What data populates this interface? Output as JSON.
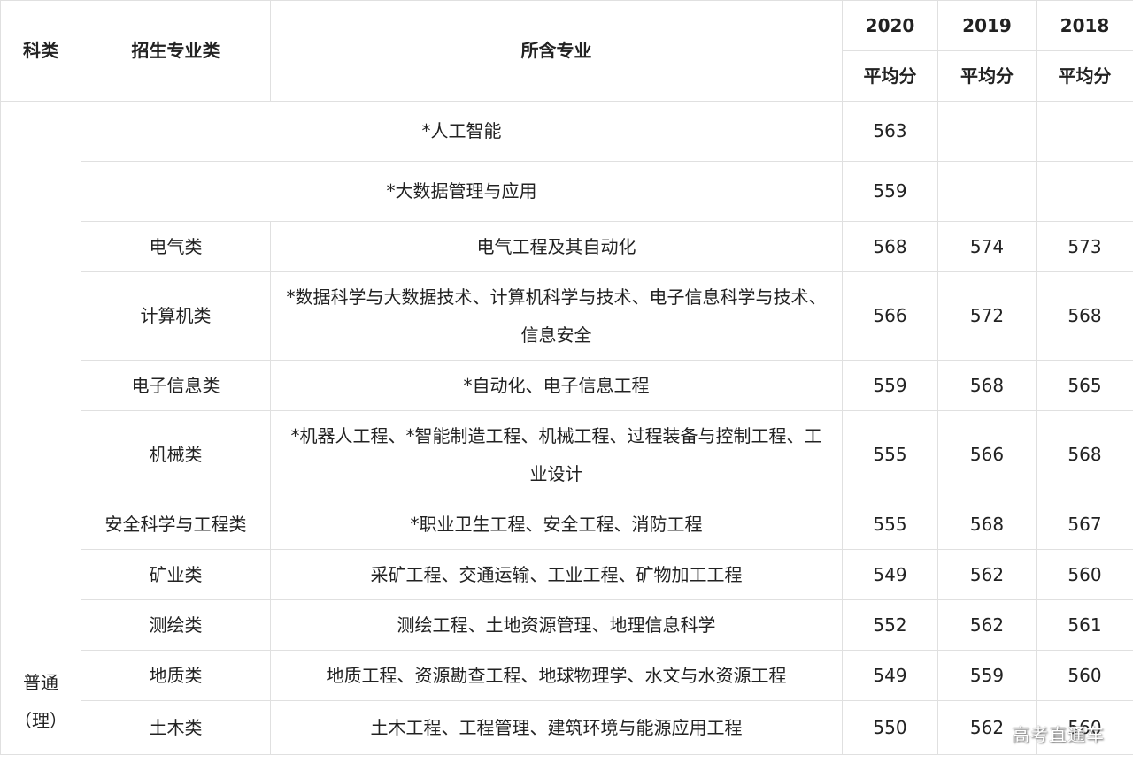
{
  "header": {
    "col_kelei": "科类",
    "col_category": "招生专业类",
    "col_majors": "所含专业",
    "years": [
      "2020",
      "2019",
      "2018"
    ],
    "avg_label": "平均分"
  },
  "kelei_label_line1": "普通",
  "kelei_label_line2": "（理）",
  "merged_rows": [
    {
      "name": "*人工智能",
      "s2020": "563",
      "s2019": "",
      "s2018": ""
    },
    {
      "name": "*大数据管理与应用",
      "s2020": "559",
      "s2019": "",
      "s2018": ""
    }
  ],
  "rows": [
    {
      "category": "电气类",
      "majors": "电气工程及其自动化",
      "s2020": "568",
      "s2019": "574",
      "s2018": "573"
    },
    {
      "category": "计算机类",
      "majors": "*数据科学与大数据技术、计算机科学与技术、电子信息科学与技术、信息安全",
      "s2020": "566",
      "s2019": "572",
      "s2018": "568"
    },
    {
      "category": "电子信息类",
      "majors": "*自动化、电子信息工程",
      "s2020": "559",
      "s2019": "568",
      "s2018": "565"
    },
    {
      "category": "机械类",
      "majors": "*机器人工程、*智能制造工程、机械工程、过程装备与控制工程、工业设计",
      "s2020": "555",
      "s2019": "566",
      "s2018": "568"
    },
    {
      "category": "安全科学与工程类",
      "majors": "*职业卫生工程、安全工程、消防工程",
      "s2020": "555",
      "s2019": "568",
      "s2018": "567"
    },
    {
      "category": "矿业类",
      "majors": "采矿工程、交通运输、工业工程、矿物加工工程",
      "s2020": "549",
      "s2019": "562",
      "s2018": "560"
    },
    {
      "category": "测绘类",
      "majors": "测绘工程、土地资源管理、地理信息科学",
      "s2020": "552",
      "s2019": "562",
      "s2018": "561"
    },
    {
      "category": "地质类",
      "majors": "地质工程、资源勘查工程、地球物理学、水文与水资源工程",
      "s2020": "549",
      "s2019": "559",
      "s2018": "560"
    },
    {
      "category": "土木类",
      "majors": "土木工程、工程管理、建筑环境与能源应用工程",
      "s2020": "550",
      "s2019": "562",
      "s2018": "560"
    }
  ],
  "watermark": "高考直通车"
}
